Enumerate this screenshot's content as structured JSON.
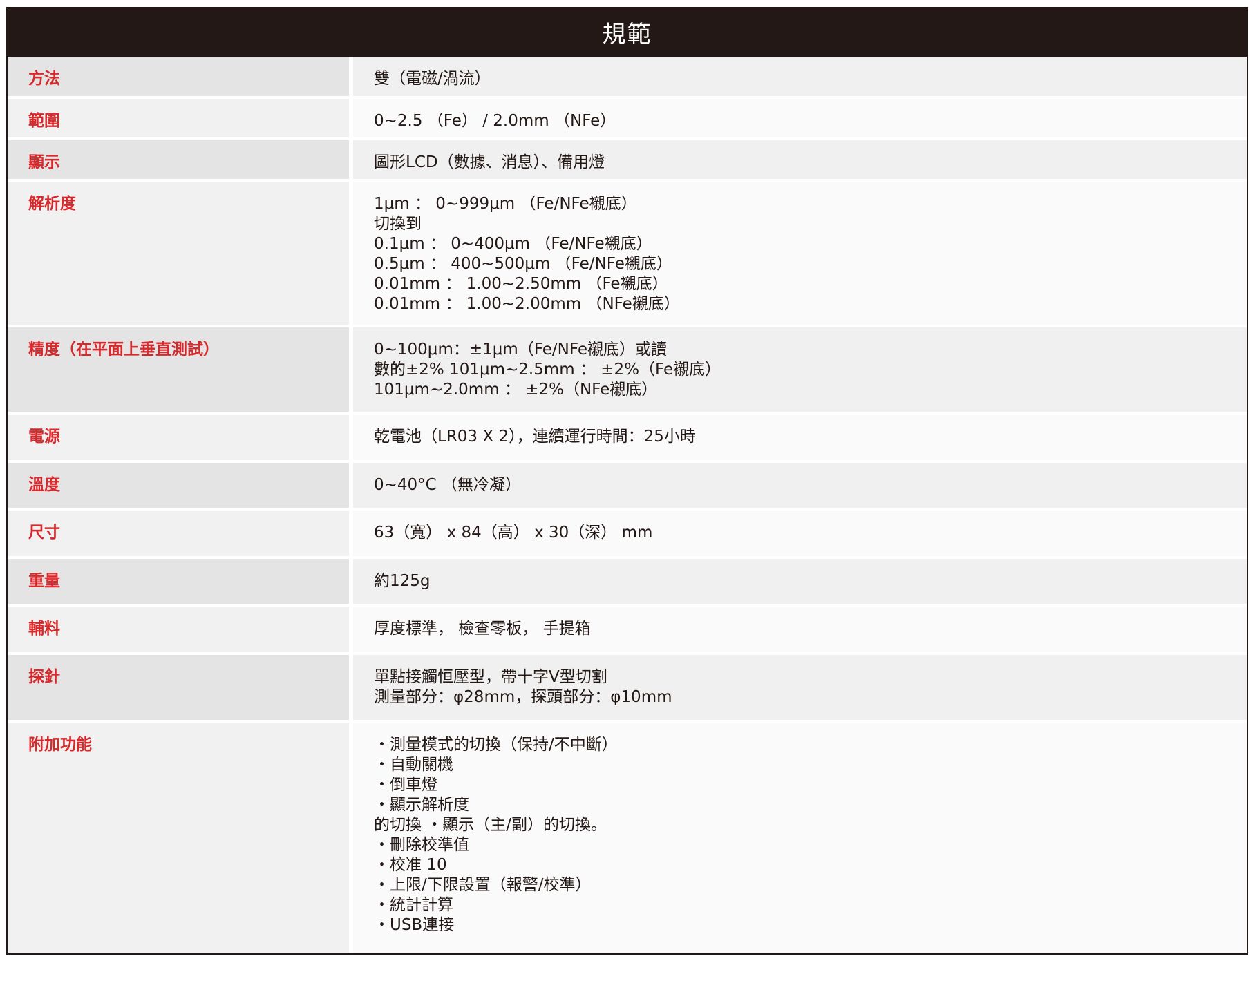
{
  "title": "規範",
  "rows": [
    {
      "label": "方法",
      "value": "雙（電磁/渦流）"
    },
    {
      "label": "範圍",
      "value": "0~2.5 （Fe） / 2.0mm （NFe）"
    },
    {
      "label": "顯示",
      "value": "圖形LCD（數據、消息）、備用燈"
    },
    {
      "label": "解析度",
      "value": "1μm ： 0~999μm （Fe/NFe襯底）\n切換到\n0.1μm ： 0~400μm （Fe/NFe襯底）\n0.5μm ： 400~500μm （Fe/NFe襯底）\n0.01mm ： 1.00~2.50mm （Fe襯底）\n0.01mm ： 1.00~2.00mm （NFe襯底）"
    },
    {
      "label": "精度（在平面上垂直測試）",
      "value": "0~100μm：±1μm（Fe/NFe襯底）或讀\n數的±2% 101μm~2.5mm ： ±2%（Fe襯底）\n101μm~2.0mm ： ±2%（NFe襯底）"
    },
    {
      "label": "電源",
      "value": "乾電池（LR03 X 2），連續運行時間：25小時"
    },
    {
      "label": "溫度",
      "value": "0~40°C （無冷凝）"
    },
    {
      "label": "尺寸",
      "value": "63（寬） x 84（高） x 30（深） mm"
    },
    {
      "label": "重量",
      "value": "約125g"
    },
    {
      "label": "輔料",
      "value": "厚度標準， 檢查零板， 手提箱"
    },
    {
      "label": "探針",
      "value": "單點接觸恒壓型，帶十字V型切割\n測量部分：φ28mm，探頭部分：φ10mm"
    },
    {
      "label": "附加功能",
      "value": "・測量模式的切換（保持/不中斷）\n・自動關機\n・倒車燈\n・顯示解析度\n的切換 ・顯示（主/副）的切換。\n・刪除校準值\n・校准 10\n・上限/下限設置（報警/校準）\n・統計計算\n・USB連接"
    }
  ]
}
